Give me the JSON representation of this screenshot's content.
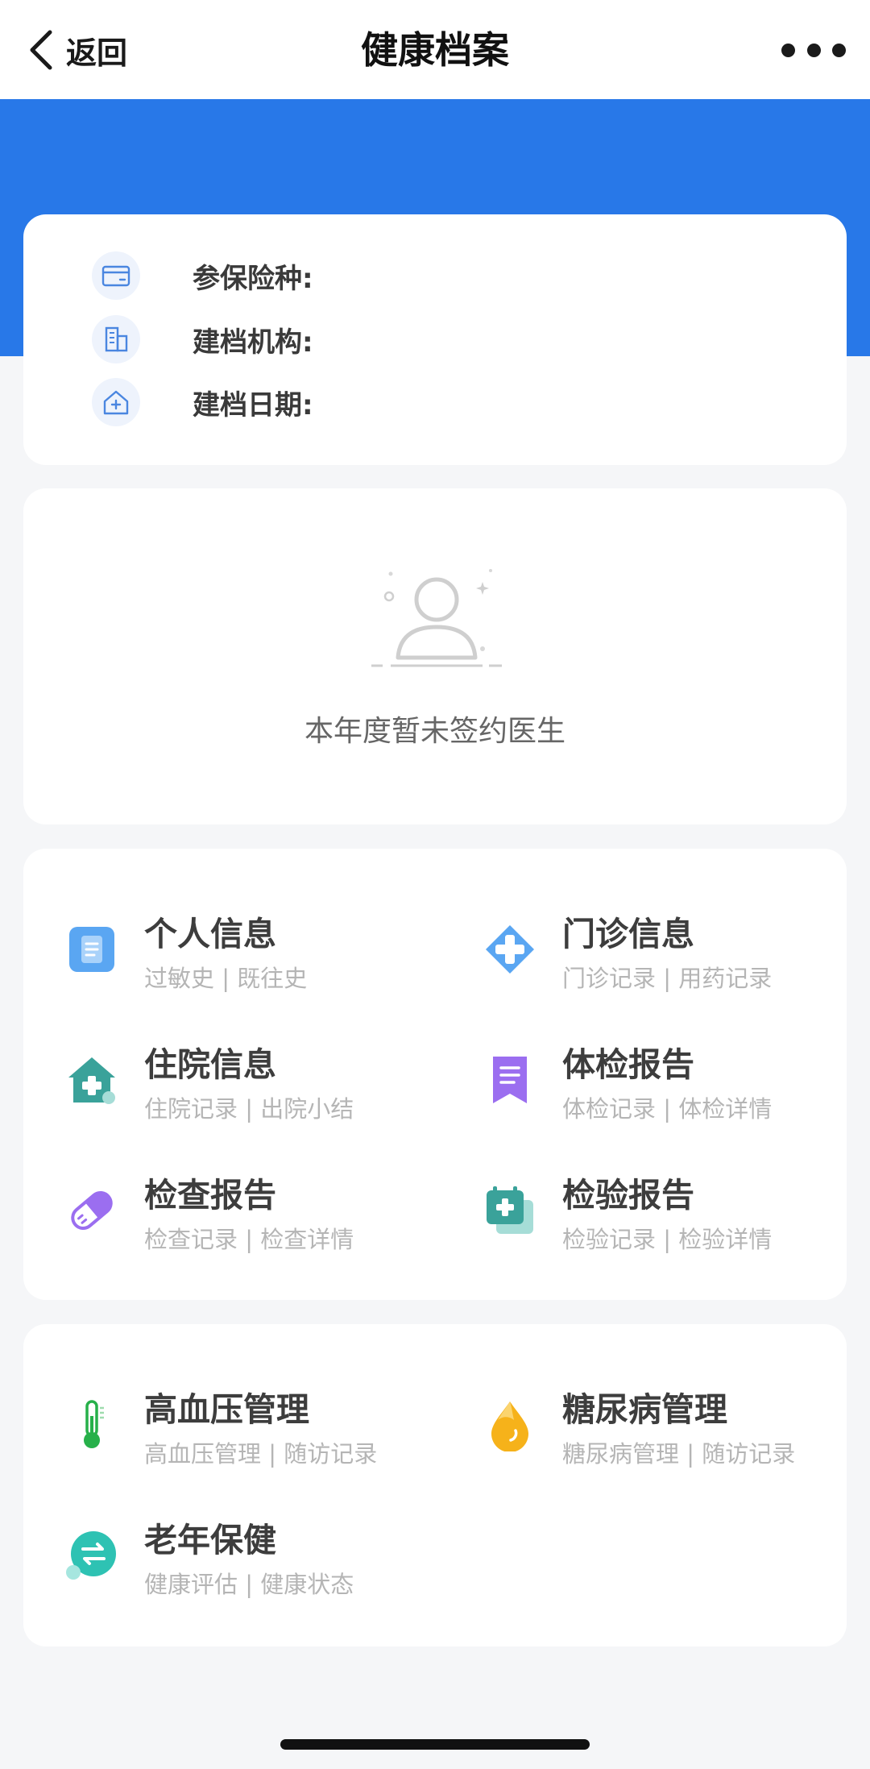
{
  "nav": {
    "back_label": "返回",
    "title": "健康档案"
  },
  "colors": {
    "brand_blue": "#2878e8",
    "page_bg": "#f5f6f8"
  },
  "archive_info": {
    "insurance_label": "参保险种:",
    "institution_label": "建档机构:",
    "date_label": "建档日期:"
  },
  "doctor": {
    "empty_text": "本年度暂未签约医生"
  },
  "records": [
    {
      "title": "个人信息",
      "subtitle": "过敏史 | 既往史",
      "icon": "document-icon"
    },
    {
      "title": "门诊信息",
      "subtitle": "门诊记录 | 用药记录",
      "icon": "medical-cross-icon"
    },
    {
      "title": "住院信息",
      "subtitle": "住院记录 | 出院小结",
      "icon": "hospital-house-icon"
    },
    {
      "title": "体检报告",
      "subtitle": "体检记录 | 体检详情",
      "icon": "bookmark-report-icon"
    },
    {
      "title": "检查报告",
      "subtitle": "检查记录 | 检查详情",
      "icon": "capsule-icon"
    },
    {
      "title": "检验报告",
      "subtitle": "检验记录 | 检验详情",
      "icon": "calendar-plus-icon"
    }
  ],
  "chronic": [
    {
      "title": "高血压管理",
      "subtitle": "高血压管理 | 随访记录",
      "icon": "thermometer-icon"
    },
    {
      "title": "糖尿病管理",
      "subtitle": "糖尿病管理 | 随访记录",
      "icon": "drop-icon"
    },
    {
      "title": "老年保健",
      "subtitle": "健康评估 | 健康状态",
      "icon": "exchange-icon"
    }
  ]
}
